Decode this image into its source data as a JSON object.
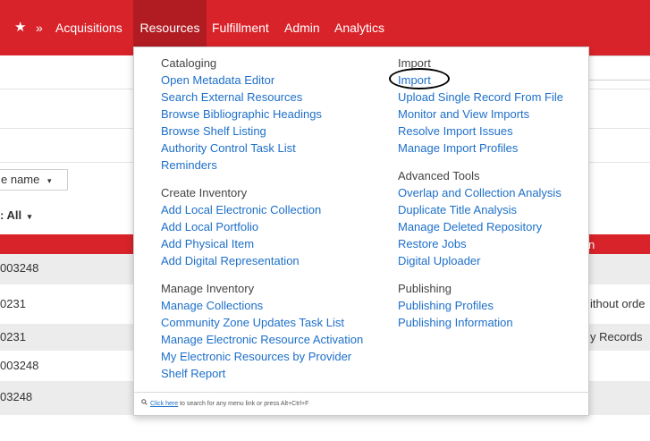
{
  "topbar": {
    "star": "★",
    "chevron": "»",
    "items": [
      "Acquisitions",
      "Resources",
      "Fulfillment",
      "Admin",
      "Analytics"
    ]
  },
  "background": {
    "name_select": "e name",
    "all_select": ": All",
    "rows": [
      {
        "left": "003248",
        "right": ""
      },
      {
        "left": "0231",
        "right": "ithout orde"
      },
      {
        "left": "0231",
        "right": "y Records"
      },
      {
        "left": "003248",
        "right": ""
      },
      {
        "left": "03248",
        "right": ""
      }
    ],
    "header_fragment": "n"
  },
  "menu": {
    "cataloging": {
      "heading": "Cataloging",
      "links": [
        "Open Metadata Editor",
        "Search External Resources",
        "Browse Bibliographic Headings",
        "Browse Shelf Listing",
        "Authority Control Task List",
        "Reminders"
      ]
    },
    "create_inventory": {
      "heading": "Create Inventory",
      "links": [
        "Add Local Electronic Collection",
        "Add Local Portfolio",
        "Add Physical Item",
        "Add Digital Representation"
      ]
    },
    "manage_inventory": {
      "heading": "Manage Inventory",
      "links": [
        "Manage Collections",
        "Community Zone Updates Task List",
        "Manage Electronic Resource Activation",
        "My Electronic Resources by Provider",
        "Shelf Report"
      ]
    },
    "import": {
      "heading": "Import",
      "links": [
        "Import",
        "Upload Single Record From File",
        "Monitor and View Imports",
        "Resolve Import Issues",
        "Manage Import Profiles"
      ]
    },
    "advanced_tools": {
      "heading": "Advanced Tools",
      "links": [
        "Overlap and Collection Analysis",
        "Duplicate Title Analysis",
        "Manage Deleted Repository",
        "Restore Jobs",
        "Digital Uploader"
      ]
    },
    "publishing": {
      "heading": "Publishing",
      "links": [
        "Publishing Profiles",
        "Publishing Information"
      ]
    },
    "footer": {
      "link": "Click here",
      "text": " to search for any menu link or press Alt+Ctrl+F"
    }
  },
  "colors": {
    "topbar": "#d8232a",
    "active_tab": "#b01c22",
    "link": "#1d6fc9"
  },
  "icons": {
    "search": "search-icon",
    "favorite": "star-icon",
    "more": "chevron-double-right-icon",
    "dropdown": "caret-down-icon"
  }
}
